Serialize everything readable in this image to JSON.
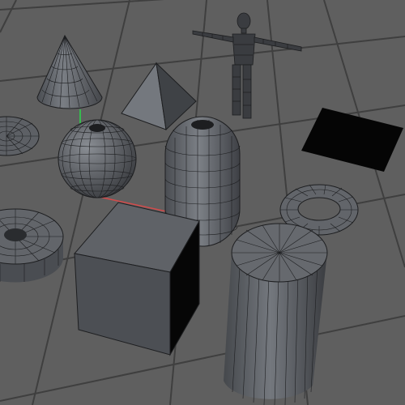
{
  "viewport": {
    "background": "#5f5f5f",
    "grid_color": "#3f3f3f",
    "object_fill": "#5a5d62",
    "wire_color": "#1d1e20",
    "axis_colors": {
      "x": "#d24b4b",
      "y": "#2bd84a",
      "z": "#2a6bd8"
    }
  },
  "objects": [
    {
      "name": "cone",
      "icon": "cone-icon"
    },
    {
      "name": "pyramid",
      "icon": "pyramid-icon"
    },
    {
      "name": "figure",
      "icon": "figure-icon"
    },
    {
      "name": "disc",
      "icon": "disc-icon"
    },
    {
      "name": "sphere",
      "icon": "sphere-icon"
    },
    {
      "name": "capsule",
      "icon": "capsule-icon"
    },
    {
      "name": "plane",
      "icon": "plane-icon"
    },
    {
      "name": "torus",
      "icon": "torus-icon"
    },
    {
      "name": "tube",
      "icon": "tube-icon"
    },
    {
      "name": "cube",
      "icon": "cube-icon"
    },
    {
      "name": "cylinder",
      "icon": "cylinder-icon"
    }
  ]
}
